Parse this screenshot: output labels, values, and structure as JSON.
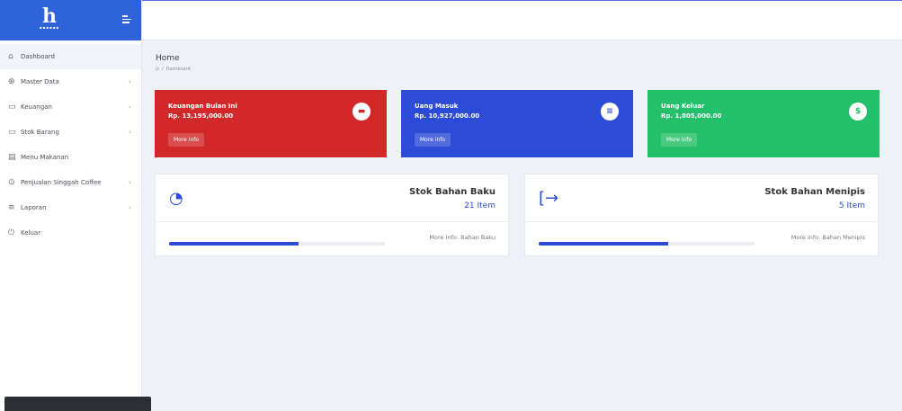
{
  "sidebar": {
    "items": [
      {
        "icon": "⌂",
        "icon_name": "home-icon",
        "label": "Dashboard",
        "chevron": false
      },
      {
        "icon": "⊕",
        "icon_name": "database-icon",
        "label": "Master Data",
        "chevron": true
      },
      {
        "icon": "▭",
        "icon_name": "folder-icon",
        "label": "Keuangan",
        "chevron": true
      },
      {
        "icon": "▭",
        "icon_name": "folder-icon",
        "label": "Stok Barang",
        "chevron": true
      },
      {
        "icon": "▤",
        "icon_name": "menu-book-icon",
        "label": "Menu Makanan",
        "chevron": false
      },
      {
        "icon": "⊙",
        "icon_name": "cart-icon",
        "label": "Penjualan Singgah Coffee",
        "chevron": true
      },
      {
        "icon": "≡",
        "icon_name": "list-icon",
        "label": "Laporan",
        "chevron": true
      },
      {
        "icon": "⏻",
        "icon_name": "power-icon",
        "label": "Keluar",
        "chevron": false
      }
    ]
  },
  "page": {
    "title": "Home",
    "breadcrumb": "Dashboard"
  },
  "info_boxes": {
    "red": {
      "title": "Keuangan Bulan Ini",
      "amount": "Rp. 13,195,000.00",
      "more": "More info",
      "icon": "▬",
      "color": "#d3282a"
    },
    "blue": {
      "title": "Uang Masuk",
      "amount": "Rp. 10,927,000.00",
      "more": "More info",
      "icon": "≡",
      "color": "#2c4bd6"
    },
    "green": {
      "title": "Uang Keluar",
      "amount": "Rp. 1,805,000.00",
      "more": "More info",
      "icon": "$",
      "color": "#24bf6a"
    }
  },
  "stats": {
    "left": {
      "label": "Stok Bahan Baku",
      "count": "21 Item",
      "more": "More Info: Bahan Baku",
      "progress": 0.6
    },
    "right": {
      "label": "Stok Bahan Menipis",
      "count": "5 Item",
      "more": "More info: Bahan Menipis",
      "progress": 0.6
    }
  }
}
